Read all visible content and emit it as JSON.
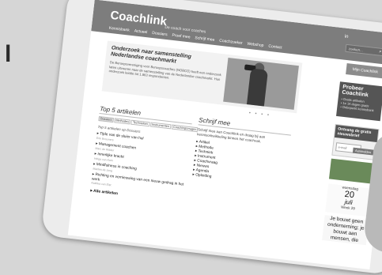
{
  "background_letter": "l",
  "header": {
    "logo": "Coachlink",
    "tagline": "De coach voor coaches",
    "social": "in",
    "search_placeholder": "zoeken..."
  },
  "nav": [
    "Kennisbank",
    "Actueel",
    "Dossiers",
    "Proef mee",
    "Schrijf mee",
    "Coachzoeker",
    "Webshop",
    "Contact"
  ],
  "mijn_label": "Mijn Coachlink",
  "hero": {
    "title": "Onderzoek naar samenstelling Nederlandse coachmarkt",
    "text": "De Beroepsvereniging voor Beroepscoaches (NOBCO) heeft een onderzoek laten uitvoeren naar de samenstelling van de Nederlandse coachmarkt. Hun onderzoek leidde tot 1.863 respondenten."
  },
  "carousel_dots": "• • • •",
  "probeer": {
    "title": "Probeer Coachlink",
    "items": [
      "• Gratis artikelen",
      "• 1e 14 dagen gratis",
      "• Onbeperkt kennisbank"
    ]
  },
  "ontvang": {
    "title": "Ontvang de gratis nieuwsbrief",
    "email_placeholder": "e-mail",
    "button": "Aanmelden"
  },
  "date_card": {
    "day": "woensdag",
    "num": "20",
    "month": "juli",
    "week": "Week 29"
  },
  "quote": "Je bouwt geen onderneming; je bouwt aan mensen, die",
  "top5": {
    "title": "Top 5 artikelen",
    "tabs": [
      "Dossiers",
      "Methodes",
      "Technieken",
      "Instrumenten",
      "Coachingsvragen"
    ],
    "subtitle": "Top 5 artikelen op Dossiers",
    "items": [
      {
        "title": "Tijde van de sluier van hul",
        "meta": "Erik Brouwers"
      },
      {
        "title": "Management coachen",
        "meta": "Marc de Ridder"
      },
      {
        "title": "Innerlijke kracht",
        "meta": "Helga van Kam"
      },
      {
        "title": "Mindfulness in coaching",
        "meta": "Marlies de Jong"
      },
      {
        "title": "Richting en vernieuwing van een nieuw gedrag in het werk",
        "meta": "Katinka van Elst"
      }
    ],
    "all_link": "Alle artikelen"
  },
  "schrijf": {
    "title": "Schrijf mee",
    "text": "Schrijf mee aan Coachlink en draag bij aan kennisontwikkeling binnen het coachvak.",
    "items": [
      "Artikel",
      "Methode",
      "Techniek",
      "Instrument",
      "Coachvraag",
      "Nieuws",
      "Agenda",
      "Opleiding"
    ]
  }
}
